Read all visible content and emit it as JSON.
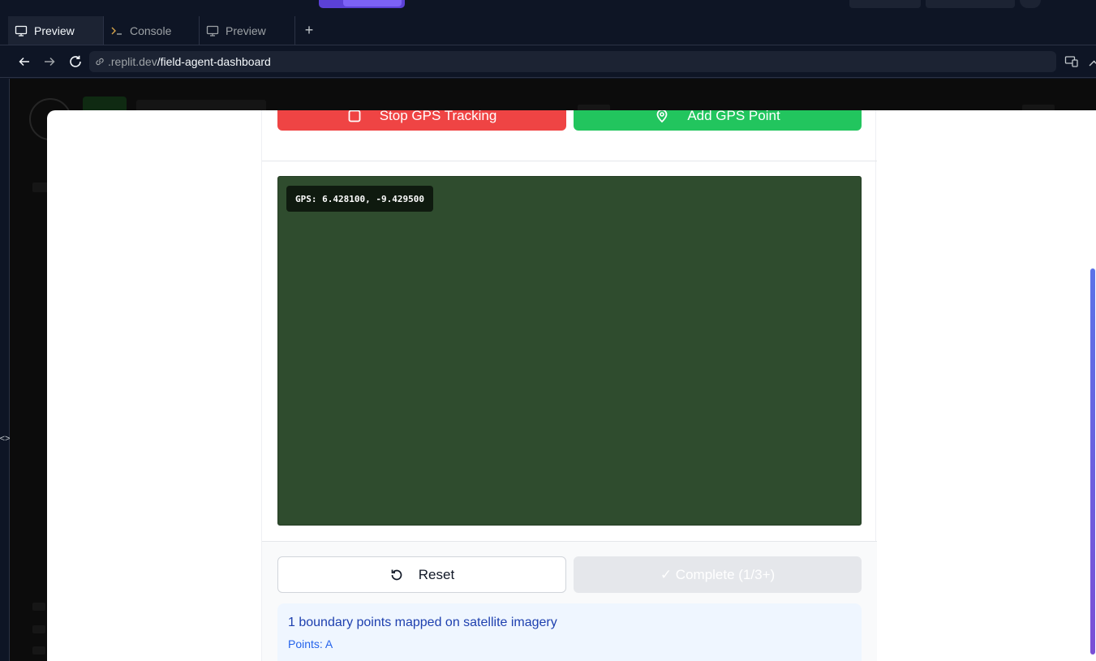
{
  "browser": {
    "tabs": [
      {
        "label": "Preview",
        "icon": "monitor-icon",
        "active": true
      },
      {
        "label": "Console",
        "icon": "terminal-icon",
        "active": false
      },
      {
        "label": "Preview",
        "icon": "monitor-icon",
        "active": false
      }
    ],
    "new_tab_icon": "plus-icon",
    "url": {
      "domain": ".replit.dev",
      "path": "/field-agent-dashboard"
    }
  },
  "modal": {
    "stop_button_label": "Stop GPS Tracking",
    "add_button_label": "Add GPS Point",
    "gps_readout": "GPS: 6.428100, -9.429500",
    "reset_button_label": "Reset",
    "complete_button_label": "✓ Complete (1/3+)",
    "info_title": "1 boundary points mapped on satellite imagery",
    "info_points": "Points: A"
  },
  "colors": {
    "stop": "#ef4444",
    "add": "#22c55e",
    "map": "#2f4c2e",
    "info_bg": "#eff6ff",
    "accent": "#1e40af"
  }
}
